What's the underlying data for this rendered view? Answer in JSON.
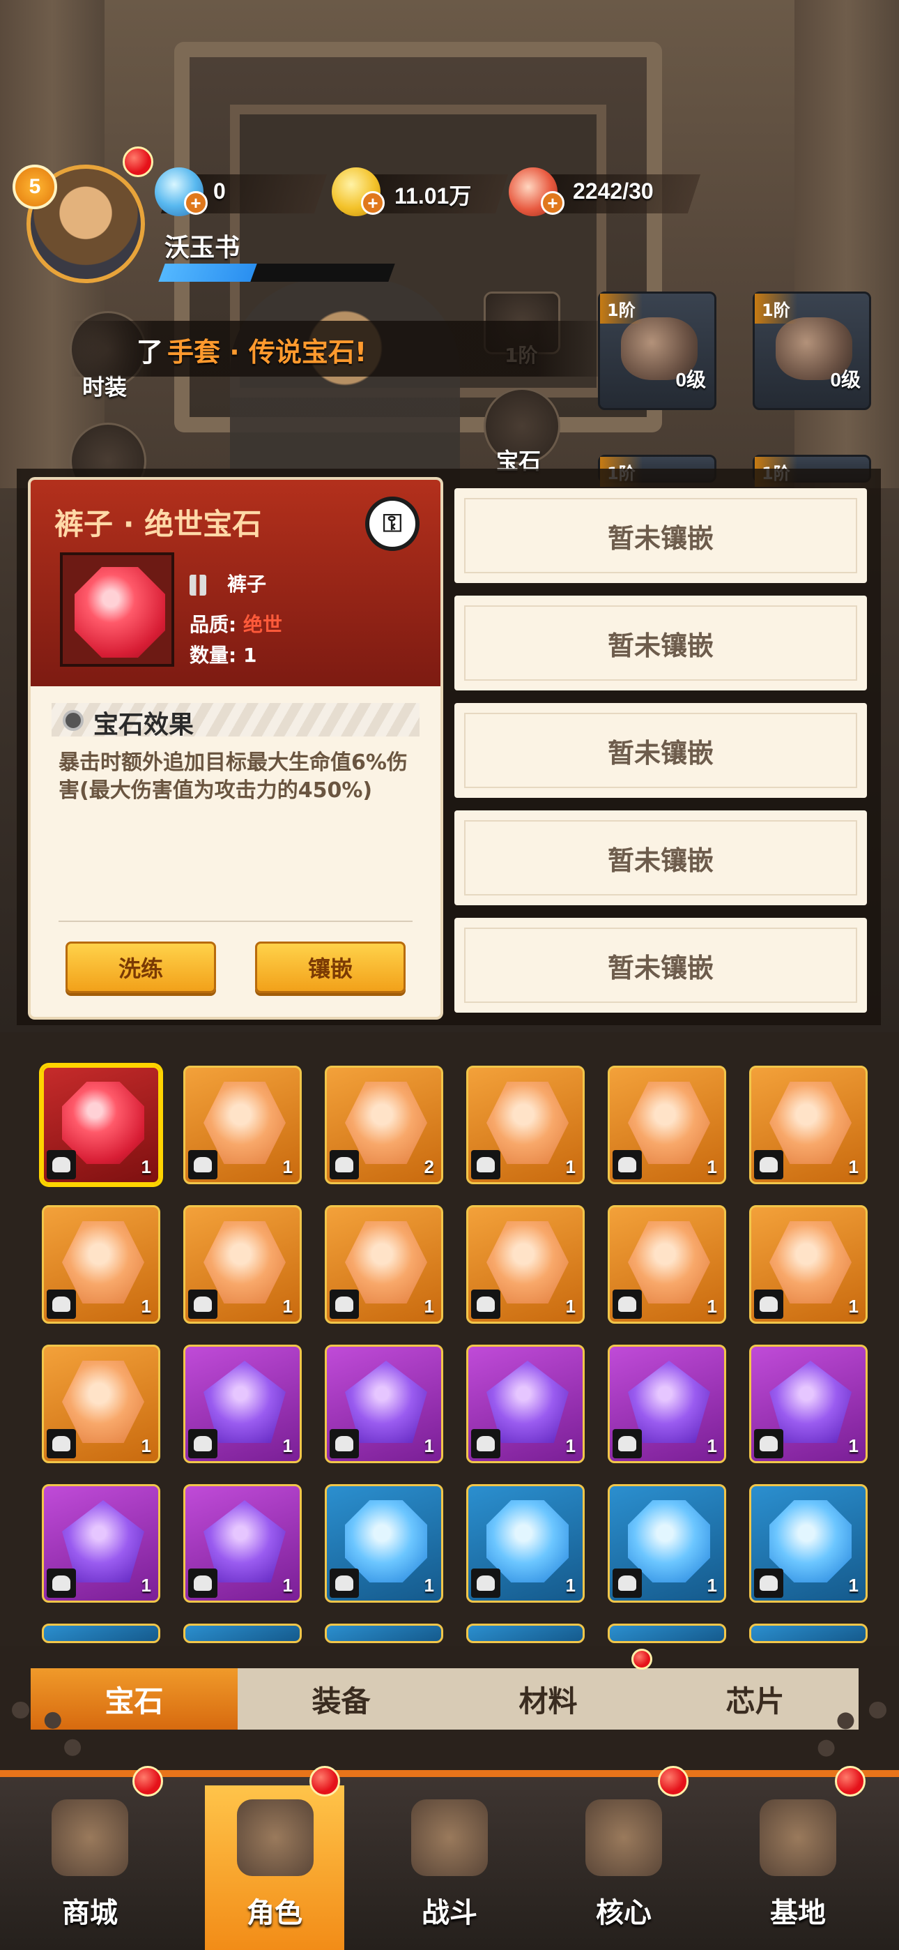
{
  "hud": {
    "level": "5",
    "player_name": "沃玉书",
    "resources": [
      {
        "icon": "diamond-icon",
        "value": "0"
      },
      {
        "icon": "coin-icon",
        "value": "11.01万"
      },
      {
        "icon": "meat-icon",
        "value": "2242/30"
      }
    ]
  },
  "side": {
    "costume_label": "时装",
    "gem_label": "宝石",
    "tier_label": "1阶"
  },
  "ticker": {
    "prefix": "了",
    "text": "手套 · 传说宝石!"
  },
  "equipment": [
    {
      "tier": "1阶",
      "level": "0级"
    },
    {
      "tier": "1阶",
      "level": "0级"
    },
    {
      "tier": "1阶"
    },
    {
      "tier": "1阶"
    }
  ],
  "popup": {
    "title": "裤子 · 绝世宝石",
    "slot_name": "裤子",
    "quality_label": "品质:",
    "quality_value": "绝世",
    "quantity_label": "数量:",
    "quantity_value": "1",
    "effect_title": "宝石效果",
    "effect_text": "暴击时额外追加目标最大生命值6%伤害(最大伤害值为攻击力的450%)",
    "refine_button": "洗练",
    "inlay_button": "镶嵌",
    "empty_slots": [
      "暂未镶嵌",
      "暂未镶嵌",
      "暂未镶嵌",
      "暂未镶嵌",
      "暂未镶嵌"
    ]
  },
  "inventory": [
    {
      "color": "red",
      "part": "pants",
      "count": "1",
      "selected": true
    },
    {
      "color": "orange",
      "part": "helmet",
      "count": "1"
    },
    {
      "color": "orange",
      "part": "helmet",
      "count": "2"
    },
    {
      "color": "orange",
      "part": "armor",
      "count": "1"
    },
    {
      "color": "orange",
      "part": "armor",
      "count": "1"
    },
    {
      "color": "orange",
      "part": "boots",
      "count": "1"
    },
    {
      "color": "orange",
      "part": "boots",
      "count": "1"
    },
    {
      "color": "orange",
      "part": "gloves",
      "count": "1"
    },
    {
      "color": "orange",
      "part": "gloves",
      "count": "1"
    },
    {
      "color": "orange",
      "part": "gloves",
      "count": "1"
    },
    {
      "color": "orange",
      "part": "hand",
      "count": "1"
    },
    {
      "color": "orange",
      "part": "hand",
      "count": "1"
    },
    {
      "color": "orange",
      "part": "hand",
      "count": "1"
    },
    {
      "color": "purple",
      "part": "helmet",
      "count": "1"
    },
    {
      "color": "purple",
      "part": "helmet",
      "count": "1"
    },
    {
      "color": "purple",
      "part": "helmet",
      "count": "1"
    },
    {
      "color": "purple",
      "part": "armor",
      "count": "1"
    },
    {
      "color": "purple",
      "part": "boots",
      "count": "1"
    },
    {
      "color": "purple",
      "part": "gloves",
      "count": "1"
    },
    {
      "color": "purple",
      "part": "pants",
      "count": "1"
    },
    {
      "color": "blue",
      "part": "helmet",
      "count": "1"
    },
    {
      "color": "blue",
      "part": "helmet",
      "count": "1"
    },
    {
      "color": "blue",
      "part": "armor",
      "count": "1"
    },
    {
      "color": "blue",
      "part": "armor",
      "count": "1"
    }
  ],
  "tabs": [
    "宝石",
    "装备",
    "材料",
    "芯片"
  ],
  "nav": [
    "商城",
    "角色",
    "战斗",
    "核心",
    "基地"
  ],
  "colors": {
    "accent": "#e8741a",
    "gem_red": "#d81e35",
    "gem_orange": "#f39a3c",
    "gem_purple": "#7b3ad8",
    "gem_blue": "#2a8ff0"
  }
}
